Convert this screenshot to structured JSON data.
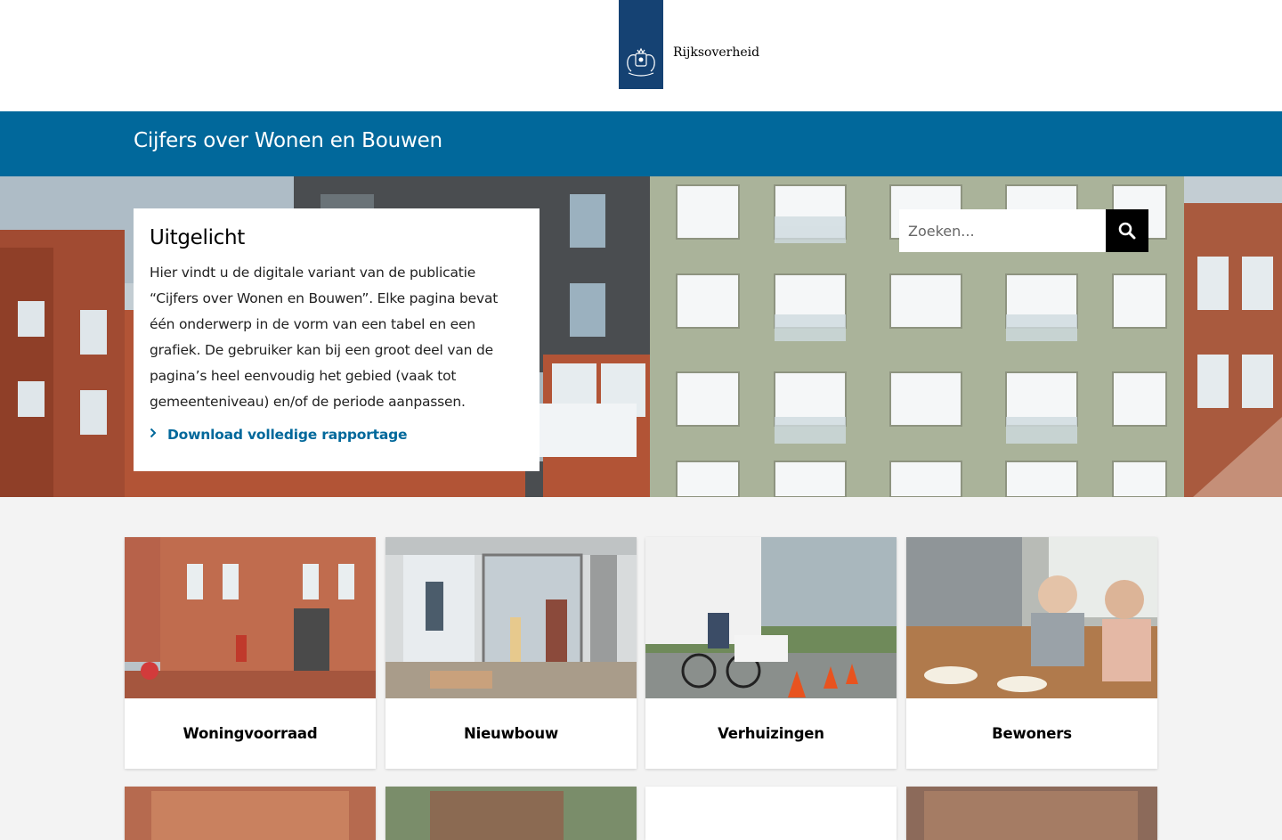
{
  "header": {
    "logo_text": "Rijksoverheid",
    "logo_color": "#154273"
  },
  "banner": {
    "title": "Cijfers over Wonen en Bouwen",
    "color": "#01689b"
  },
  "featured": {
    "title": "Uitgelicht",
    "body": "Hier vindt u de digitale variant van de publicatie “Cijfers over Wonen en Bouwen”. Elke pagina bevat één onderwerp in de vorm van een tabel en een grafiek. De gebruiker kan bij een groot deel van de pagina’s heel eenvoudig het gebied (vaak tot gemeenteniveau) en/of de periode aanpassen.",
    "link_label": "Download volledige rapportage",
    "link_icon": "chevron-right-icon"
  },
  "search": {
    "placeholder": "Zoeken...",
    "value": "",
    "button_icon": "search-icon"
  },
  "cards": [
    {
      "label": "Woningvoorraad"
    },
    {
      "label": "Nieuwbouw"
    },
    {
      "label": "Verhuizingen"
    },
    {
      "label": "Bewoners"
    }
  ]
}
